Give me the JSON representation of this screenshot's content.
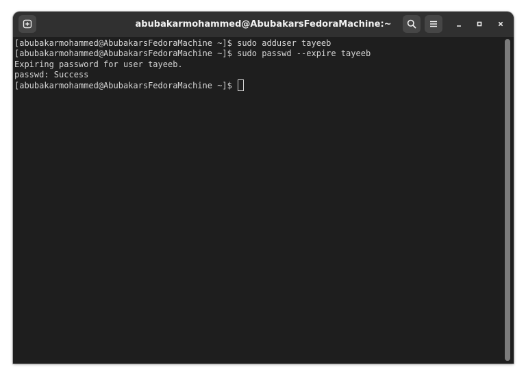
{
  "window": {
    "title": "abubakarmohammed@AbubakarsFedoraMachine:~"
  },
  "headerbar": {
    "new_tab_icon": "new-tab-icon",
    "search_icon": "search-icon",
    "menu_icon": "hamburger-menu-icon",
    "minimize_icon": "minimize-icon",
    "maximize_icon": "maximize-icon",
    "close_icon": "close-icon"
  },
  "terminal": {
    "lines": [
      "[abubakarmohammed@AbubakarsFedoraMachine ~]$ sudo adduser tayeeb",
      "[abubakarmohammed@AbubakarsFedoraMachine ~]$ sudo passwd --expire tayeeb",
      "Expiring password for user tayeeb.",
      "passwd: Success"
    ],
    "prompt": "[abubakarmohammed@AbubakarsFedoraMachine ~]$ "
  },
  "colors": {
    "background": "#1e1e1e",
    "headerbar": "#303030",
    "text": "#d6d6d6",
    "scrollbar": "#7c7c7c"
  }
}
